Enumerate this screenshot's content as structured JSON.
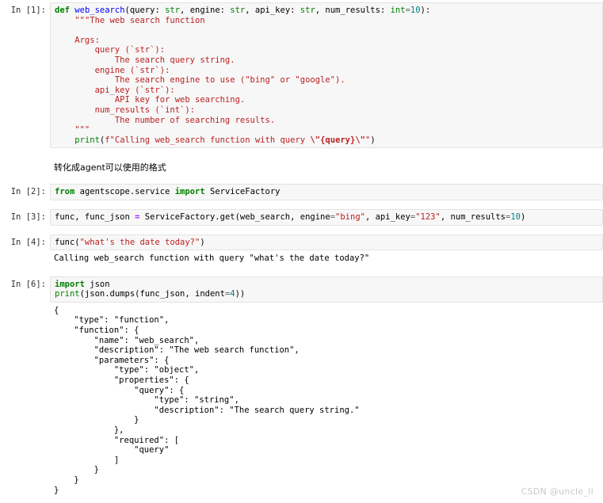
{
  "notebook": {
    "watermark": "CSDN @uncle_ll",
    "cells": [
      {
        "type": "code",
        "prompt": "In [1]:",
        "source": "def web_search(query: str, engine: str, api_key: str, num_results: int=10):\n    \"\"\"The web search function\n\n    Args:\n        query (`str`):\n            The search query string.\n        engine (`str`):\n            The search engine to use (\"bing\" or \"google\").\n        api_key (`str`):\n            API key for web searching.\n        num_results (`int`):\n            The number of searching results.\n    \"\"\"\n    print(f\"Calling web_search function with query \\\"{query}\\\"\")",
        "output": null
      },
      {
        "type": "markdown",
        "prompt": "",
        "source": "转化成agent可以使用的格式",
        "output": null
      },
      {
        "type": "code",
        "prompt": "In [2]:",
        "source": "from agentscope.service import ServiceFactory",
        "output": null
      },
      {
        "type": "code",
        "prompt": "In [3]:",
        "source": "func, func_json = ServiceFactory.get(web_search, engine=\"bing\", api_key=\"123\", num_results=10)",
        "output": null
      },
      {
        "type": "code",
        "prompt": "In [4]:",
        "source": "func(\"what's the date today?\")",
        "output": "Calling web_search function with query \"what's the date today?\""
      },
      {
        "type": "code",
        "prompt": "In [6]:",
        "source": "import json\nprint(json.dumps(func_json, indent=4))",
        "output": "{\n    \"type\": \"function\",\n    \"function\": {\n        \"name\": \"web_search\",\n        \"description\": \"The web search function\",\n        \"parameters\": {\n            \"type\": \"object\",\n            \"properties\": {\n                \"query\": {\n                    \"type\": \"string\",\n                    \"description\": \"The search query string.\"\n                }\n            },\n            \"required\": [\n                \"query\"\n            ]\n        }\n    }\n}"
      }
    ]
  },
  "colors": {
    "cell_background": "#f7f7f7",
    "cell_border": "#e3e3e3",
    "keyword": "#008000",
    "function_name": "#0000ff",
    "builtin": "#008000",
    "string": "#ba2121",
    "number": "#008080",
    "operator": "#aa22ff",
    "text": "#000000",
    "watermark": "#c9c9c9"
  }
}
